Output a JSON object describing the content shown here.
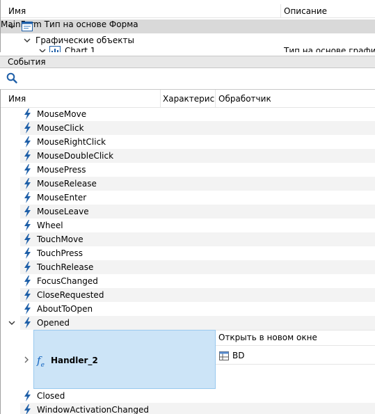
{
  "tree": {
    "col_name": "Имя",
    "col_description": "Описание",
    "rows": [
      {
        "label": "MainForm",
        "description": "Тип на основе Форма",
        "chevron": "expanded"
      },
      {
        "label": "Графические объекты",
        "chevron": "expanded"
      },
      {
        "label": "Chart 1",
        "description": "Тип на основе графика",
        "chevron": "expanded"
      }
    ]
  },
  "events_section": {
    "title": "События",
    "search_icon": "search-icon"
  },
  "events": {
    "col_name": "Имя",
    "col_characteristics": "Характеристики",
    "col_handler": "Обработчик",
    "items": [
      {
        "label": "MouseMove"
      },
      {
        "label": "MouseClick"
      },
      {
        "label": "MouseRightClick"
      },
      {
        "label": "MouseDoubleClick"
      },
      {
        "label": "MousePress"
      },
      {
        "label": "MouseRelease"
      },
      {
        "label": "MouseEnter"
      },
      {
        "label": "MouseLeave"
      },
      {
        "label": "Wheel"
      },
      {
        "label": "TouchMove"
      },
      {
        "label": "TouchPress"
      },
      {
        "label": "TouchRelease"
      },
      {
        "label": "FocusChanged"
      },
      {
        "label": "CloseRequested"
      },
      {
        "label": "AboutToOpen"
      },
      {
        "label": "Opened"
      }
    ],
    "handler": {
      "name": "Handler_2",
      "fe_glyph": "f",
      "fe_sub": "e",
      "open_mode": "Открыть в новом окне",
      "target": "BD"
    },
    "after_items": [
      {
        "label": "Closed"
      },
      {
        "label": "WindowActivationChanged"
      }
    ]
  },
  "colors": {
    "selected_bg": "#cce4f7",
    "bolt": "#1e5fa8",
    "highlight_row": "#d9d9d9"
  }
}
